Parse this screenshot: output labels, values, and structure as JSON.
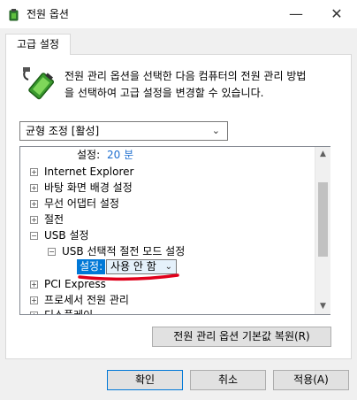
{
  "window": {
    "title": "전원 옵션",
    "minimize_glyph": "—",
    "close_glyph": "✕",
    "icon": "power-options-icon"
  },
  "tab": {
    "label": "고급 설정"
  },
  "description": {
    "line1": "전원 관리 옵션을 선택한 다음 컴퓨터의 전원 관리 방법",
    "line2": "을 선택하여 고급 설정을 변경할 수 있습니다.",
    "icon": "battery-plug-icon"
  },
  "plan_select": {
    "value": "균형 조정 [활성]"
  },
  "tree": {
    "setting_label": "설정:",
    "setting_value": "20 분",
    "items": [
      {
        "label": "Internet Explorer",
        "expander": "+"
      },
      {
        "label": "바탕 화면 배경 설정",
        "expander": "+"
      },
      {
        "label": "무선 어댑터 설정",
        "expander": "+"
      },
      {
        "label": "절전",
        "expander": "+"
      },
      {
        "label": "USB 설정",
        "expander": "−"
      },
      {
        "label": "USB 선택적 절전 모드 설정",
        "expander": "−"
      },
      {
        "label": "PCI Express",
        "expander": "+"
      },
      {
        "label": "프로세서 전원 관리",
        "expander": "+"
      },
      {
        "label": "디스플레이",
        "expander": "+"
      }
    ],
    "usb_setting": {
      "label": "설정:",
      "value": "사용 안 함"
    }
  },
  "colors": {
    "selection": "#0078d7",
    "annotation": "#e0001b",
    "link_value": "#1e6ecf"
  },
  "buttons": {
    "restore_defaults": "전원 관리 옵션 기본값 복원(R)",
    "ok": "확인",
    "cancel": "취소",
    "apply": "적용(A)"
  }
}
